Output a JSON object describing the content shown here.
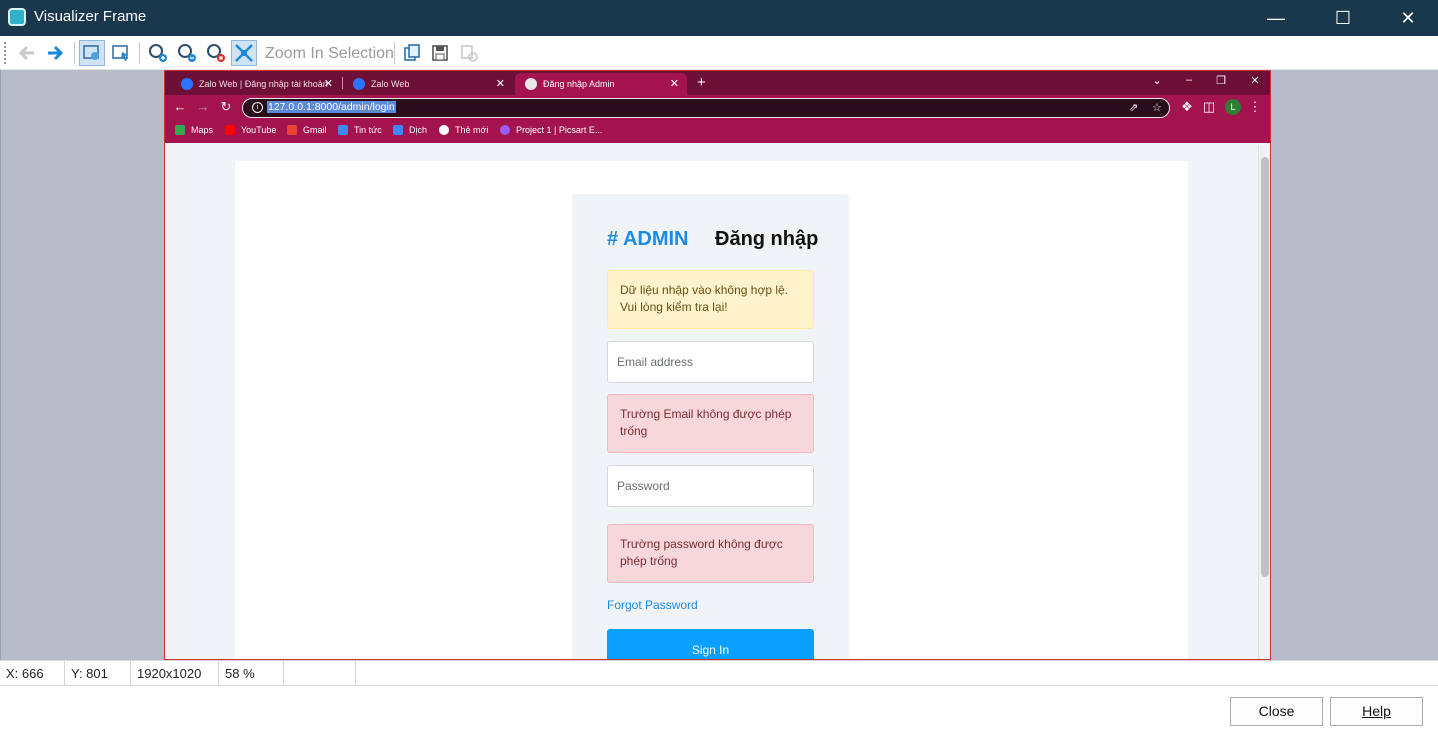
{
  "window": {
    "title": "Visualizer Frame"
  },
  "toolbar": {
    "zoom_in_selection_label": "Zoom In Selection"
  },
  "browser": {
    "tabs": [
      {
        "label": "Zalo Web | Đăng nhập tài khoản"
      },
      {
        "label": "Zalo Web"
      },
      {
        "label": "Đăng nhập Admin"
      }
    ],
    "url": "127.0.0.1:8000/admin/login",
    "profile_initial": "L",
    "bookmarks": [
      {
        "label": "Maps",
        "color": "#34a853"
      },
      {
        "label": "YouTube",
        "color": "#ff0000"
      },
      {
        "label": "Gmail",
        "color": "#ea4335"
      },
      {
        "label": "Tin tức",
        "color": "#4285f4"
      },
      {
        "label": "Dịch",
        "color": "#4285f4"
      },
      {
        "label": "Thẻ mới",
        "color": "#ffffff"
      },
      {
        "label": "Project 1 | Picsart E...",
        "color": "#9c5cf5"
      }
    ]
  },
  "login": {
    "brand": "# ADMIN",
    "heading": "Đăng nhập",
    "alert_invalid": "Dữ liệu nhập vào không hợp lệ. Vui lòng kiểm tra lại!",
    "email_placeholder": "Email address",
    "email_error": "Trường Email không được phép trống",
    "password_placeholder": "Password",
    "password_error": "Trường password không được phép trống",
    "forgot_password": "Forgot Password",
    "sign_in": "Sign In"
  },
  "statusbar": {
    "x": "X: 666",
    "y": "Y: 801",
    "resolution": "1920x1020",
    "zoom": "58 %"
  },
  "footer": {
    "close_label": "Close",
    "help_label": "Help"
  },
  "colors": {
    "titlebar": "#19374d",
    "browser_theme": "#a3144e",
    "accent": "#1a8be6",
    "button": "#0aa0ff"
  }
}
